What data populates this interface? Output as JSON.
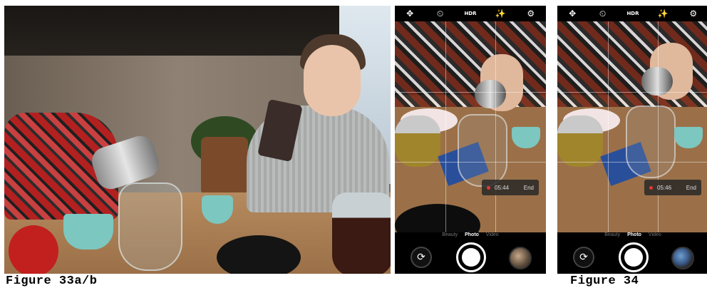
{
  "captions": {
    "left": "Figure 33a/b",
    "right": "Figure 34"
  },
  "camera_ui": {
    "top_icons": [
      "grid-icon",
      "timer-icon",
      "hdr-icon",
      "beauty-icon",
      "gear-icon"
    ],
    "top_glyphs": [
      "✥",
      "⏲",
      "HDR",
      "✨",
      "⚙"
    ],
    "modes": [
      "Beauty",
      "Photo",
      "Video"
    ],
    "selected_mode": "Photo",
    "end_label": "End",
    "screen_b": {
      "timer": "05:44"
    },
    "screen_c": {
      "timer": "05:46"
    }
  }
}
